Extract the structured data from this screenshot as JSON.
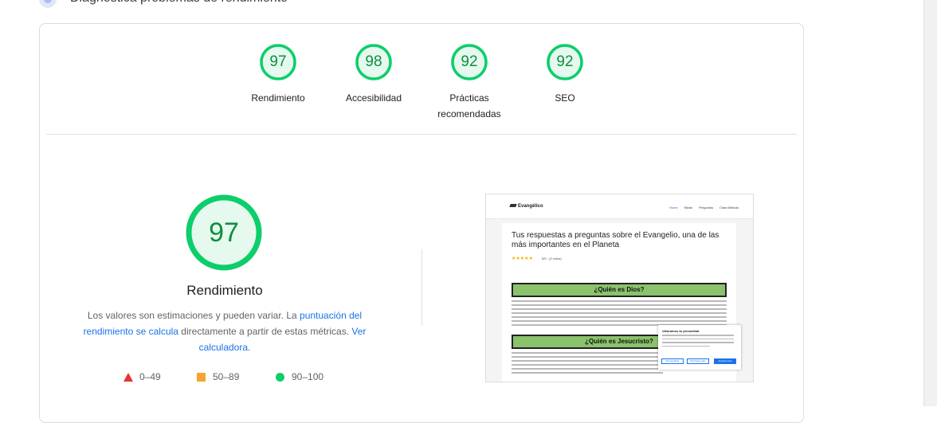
{
  "header": {
    "title": "Diagnostica problemas de rendimiento"
  },
  "colors": {
    "pass": "#0cce6b",
    "pass_text": "#0c8f3f",
    "pass_fill": "#e6f9ee",
    "average": "#f5a431",
    "fail": "#e8332b",
    "link": "#1a73e8"
  },
  "categories": [
    {
      "score": 97,
      "label": "Rendimiento"
    },
    {
      "score": 98,
      "label": "Accesibilidad"
    },
    {
      "score": 92,
      "label": "Prácticas recomendadas"
    },
    {
      "score": 92,
      "label": "SEO"
    }
  ],
  "performance": {
    "score": 97,
    "title": "Rendimiento",
    "desc_text_1": "Los valores son estimaciones y pueden variar. La ",
    "desc_link_1": "puntuación del rendimiento se calcula",
    "desc_text_2": " directamente a partir de estas métricas. ",
    "desc_link_2": "Ver calculadora",
    "desc_text_3": "."
  },
  "legend": [
    {
      "icon": "triangle-icon",
      "range": "0–49"
    },
    {
      "icon": "square-icon",
      "range": "50–89"
    },
    {
      "icon": "circle-icon",
      "range": "90–100"
    }
  ],
  "screenshot": {
    "logo": "Evangélico",
    "menu": [
      "Home",
      "Biblia",
      "Preguntas",
      "Citas Bíblicas"
    ],
    "headline": "Tus respuestas a preguntas sobre el Evangelio, una de las más importantes en el Planeta",
    "stars": "★★★★★",
    "votes": "5/5 · (2 votos)",
    "section1": "¿Quién es Dios?",
    "section2": "¿Quién es Jesucristo?",
    "cookie_title": "Valoramos tu privacidad",
    "cookie_buttons": [
      "Personalizar",
      "Rechazar todo",
      "Aceptar todo"
    ]
  }
}
